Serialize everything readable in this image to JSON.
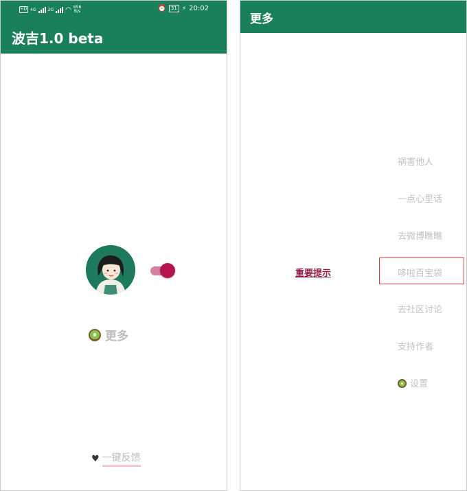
{
  "status_bar": {
    "network": "HD",
    "sim1": "4G",
    "sim2": "2G",
    "speed_value": "656",
    "speed_unit": "B/s",
    "alarm_icon": "alarm-clock-icon",
    "battery": "31",
    "time": "20:02"
  },
  "left_screen": {
    "app_title": "波吉1.0 beta",
    "toggle_on": true,
    "more_label": "更多",
    "feedback_heart": "♥",
    "feedback_label": "一键反馈"
  },
  "right_screen": {
    "title": "更多",
    "notice_label": "重要提示",
    "menu_items": [
      {
        "label": "祸害他人"
      },
      {
        "label": "一点心里话"
      },
      {
        "label": "去微博瞧瞧"
      },
      {
        "label": "哆啦百宝袋"
      },
      {
        "label": "去社区讨论"
      },
      {
        "label": "支持作者"
      },
      {
        "label": "设置"
      }
    ]
  },
  "colors": {
    "app_bar": "#1a8059",
    "toggle_thumb": "#b5154f",
    "toggle_track": "#d77fa0",
    "notice_text": "#8d1d46",
    "menu_text": "#c2c2c2",
    "highlight_border": "#e23a3a"
  }
}
